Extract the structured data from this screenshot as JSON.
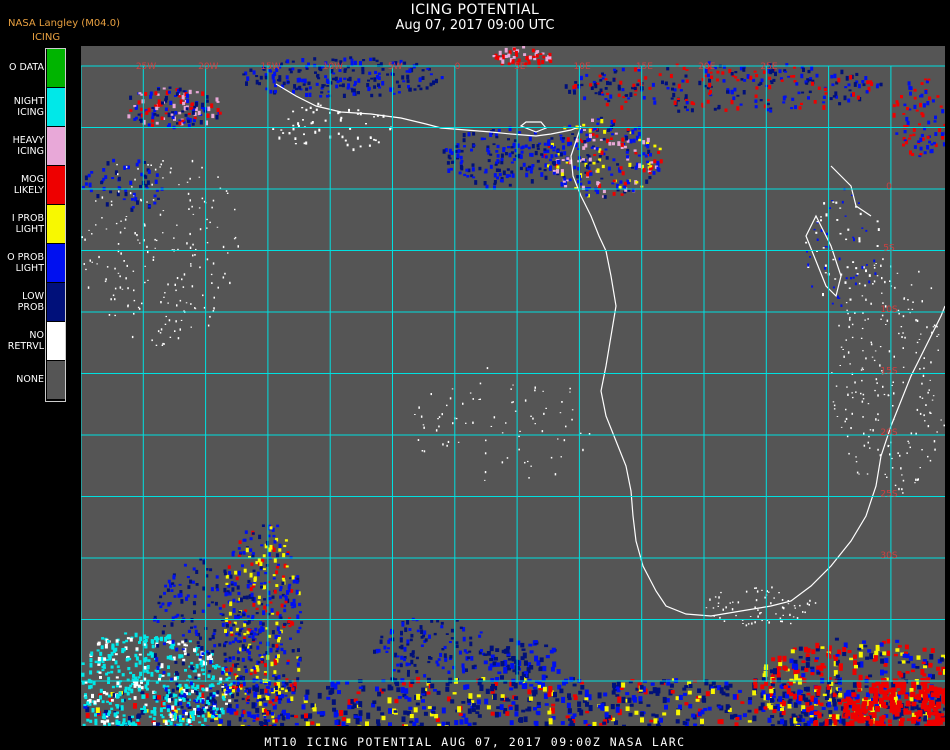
{
  "header": {
    "source": "NASA Langley (M04.0)",
    "product": "ICING",
    "title": "ICING POTENTIAL",
    "datetime": "Aug 07, 2017 09:00 UTC"
  },
  "legend": [
    {
      "label": "O DATA",
      "color": "#00b400"
    },
    {
      "label": "NIGHT\nICING",
      "color": "#00e8e8"
    },
    {
      "label": "HEAVY\nICING",
      "color": "#e8a8d8"
    },
    {
      "label": "MOG\nLIKELY",
      "color": "#ee0000"
    },
    {
      "label": "I PROB\nLIGHT",
      "color": "#f8f800"
    },
    {
      "label": "O PROB\nLIGHT",
      "color": "#0010f0"
    },
    {
      "label": "LOW\nPROB",
      "color": "#00107a"
    },
    {
      "label": "NO\nRETRVL",
      "color": "#ffffff"
    },
    {
      "label": "NONE",
      "color": "#555555"
    }
  ],
  "map": {
    "grid_color": "#00e0e0",
    "coast_color": "#ffffff",
    "lon_labels": [
      "25W",
      "20W",
      "15W",
      "10W",
      "5W",
      "0",
      "5E",
      "10E",
      "15E",
      "20E",
      "25E"
    ],
    "lat_labels": [
      "0",
      "5S",
      "10S",
      "15S",
      "20S",
      "25S",
      "30S"
    ],
    "lat_label_color": "#d04040"
  },
  "footer": {
    "text": "MT10  ICING POTENTIAL   AUG 07, 2017 09:00Z   NASA LARC"
  }
}
